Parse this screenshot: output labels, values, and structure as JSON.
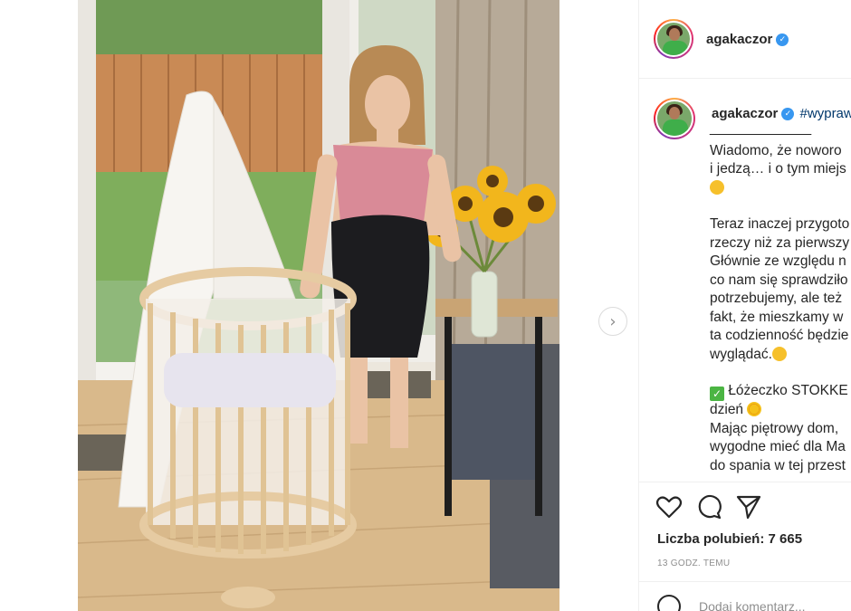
{
  "post": {
    "username": "agakaczor",
    "hashtag": "#wypraw",
    "caption": {
      "divider": "_____________",
      "p1": "Wiadomo, że noworo\ni jedzą… i o tym miejs",
      "p2": "Teraz inaczej przygoto\nrzeczy niż za pierwszy\nGłównie ze względu n\nco nam się sprawdziło\npotrzebujemy, ale też\nfakt, że mieszkamy w\nta codzienność będzie\nwyglądać.",
      "p3a": "Łóżeczko STOKKE",
      "p3b": "dzień",
      "p4": "Mając piętrowy dom,\nwygodne mieć dla Ma\ndo spania w tej przest"
    },
    "likes_label": "Liczba polubień: 7 665",
    "time_label": "13 GODZ. TEMU",
    "comment_placeholder": "Dodaj komentarz..."
  },
  "icons": {
    "verified": "verified-badge-icon",
    "next": "chevron-right-icon",
    "like": "heart-icon",
    "comment": "comment-bubble-icon",
    "share": "paper-plane-icon",
    "emoji": "smiley-icon"
  },
  "colors": {
    "link": "#00376b",
    "verified": "#3897f0",
    "muted": "#8e8e8e"
  }
}
